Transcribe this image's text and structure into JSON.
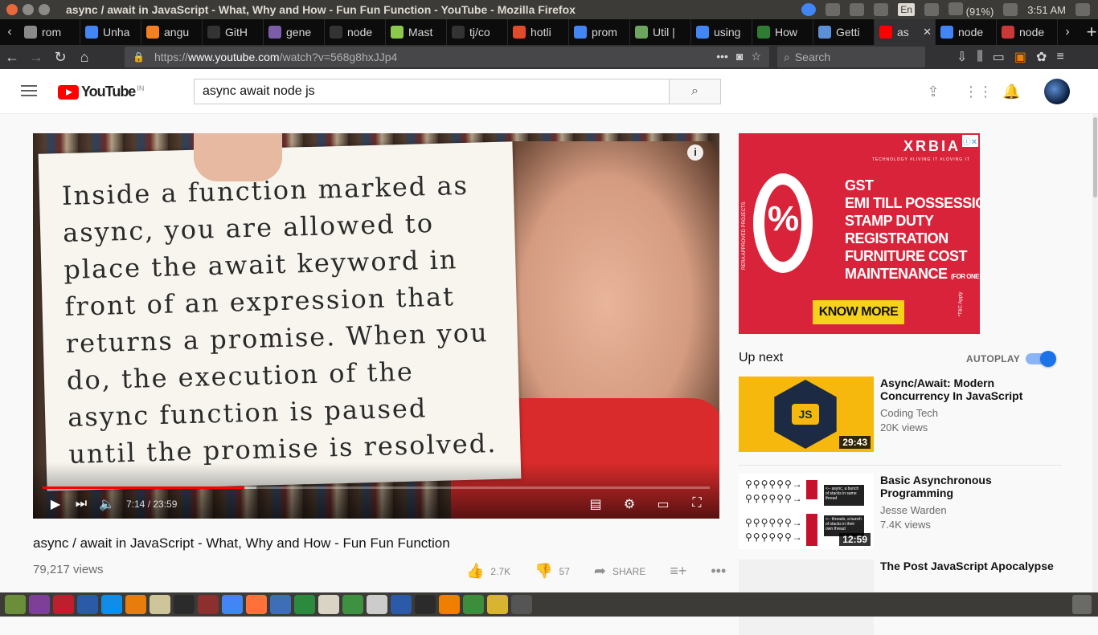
{
  "os": {
    "window_title": "async / await in JavaScript - What, Why and How - Fun Fun Function - YouTube - Mozilla Firefox",
    "lang": "En",
    "battery": "(91%)",
    "clock": "3:51 AM"
  },
  "tabs": [
    {
      "label": "rom",
      "color": "#8a8a8a"
    },
    {
      "label": "Unha",
      "color": "#4285f4"
    },
    {
      "label": "angu",
      "color": "#f48024"
    },
    {
      "label": "GitH",
      "color": "#333333"
    },
    {
      "label": "gene",
      "color": "#7b5ea7"
    },
    {
      "label": "node",
      "color": "#333333"
    },
    {
      "label": "Mast",
      "color": "#8cc84b"
    },
    {
      "label": "tj/co",
      "color": "#333333"
    },
    {
      "label": "hotli",
      "color": "#e14a2b"
    },
    {
      "label": "prom",
      "color": "#4285f4"
    },
    {
      "label": "Util |",
      "color": "#6da55f"
    },
    {
      "label": "using",
      "color": "#4285f4"
    },
    {
      "label": "How",
      "color": "#2e7d32"
    },
    {
      "label": "Getti",
      "color": "#5c8fd6"
    },
    {
      "label": "as",
      "color": "#ff0000",
      "active": true
    },
    {
      "label": "node",
      "color": "#4285f4"
    },
    {
      "label": "node",
      "color": "#cb3837"
    }
  ],
  "nav": {
    "url_prefix": "https://",
    "url_host": "www.youtube.com",
    "url_path": "/watch?v=568g8hxJJp4",
    "search_placeholder": "Search"
  },
  "youtube": {
    "logo": "YouTube",
    "country": "IN",
    "search_value": "async await node js"
  },
  "video": {
    "sign_text": "Inside a function marked as async, you are allowed to place the await keyword in front of an expression that returns a promise. When you do, the execution of the async function is paused until the promise is resolved.",
    "time": "7:14 / 23:59",
    "progress_played": 0.303,
    "progress_buffered": 0.32,
    "title": "async / await in JavaScript - What, Why and How - Fun Fun Function",
    "views": "79,217 views",
    "likes": "2.7K",
    "dislikes": "57",
    "share": "SHARE"
  },
  "ad": {
    "brand": "XRBIA",
    "tagline": "TECHNOLOGY #LIVING IT #LOVING IT",
    "lines": [
      "GST",
      "EMI TILL POSSESSION",
      "STAMP DUTY",
      "REGISTRATION",
      "FURNITURE COST",
      "MAINTENANCE"
    ],
    "for_one_year": "(FOR ONE YEAR)",
    "cta": "KNOW MORE",
    "side_text": "RERA APPROVED PROJECTS",
    "tc": "*T&C Apply"
  },
  "sidebar": {
    "up_next": "Up next",
    "autoplay": "AUTOPLAY",
    "recommendations": [
      {
        "title": "Async/Await: Modern Concurrency In JavaScript",
        "channel": "Coding Tech",
        "views": "20K views",
        "duration": "29:43",
        "badge": "JS"
      },
      {
        "title": "Basic Asynchronous Programming",
        "channel": "Jesse Warden",
        "views": "7.4K views",
        "duration": "12:59",
        "note1": "<-- async, a bunch of stacks in same thread",
        "note2": "<-- threads, a bunch of stacks in their own thread"
      },
      {
        "title": "The Post JavaScript Apocalypse",
        "channel": "",
        "views": "",
        "duration": ""
      }
    ]
  },
  "taskbar": [
    {
      "name": "ubuntu-dash",
      "color": "#6b8e3a"
    },
    {
      "name": "purple-app",
      "color": "#7e3f98"
    },
    {
      "name": "filezilla",
      "color": "#bf1e2d"
    },
    {
      "name": "visual-studio",
      "color": "#2a5aa8"
    },
    {
      "name": "teamviewer",
      "color": "#0e8ee9"
    },
    {
      "name": "blender",
      "color": "#e87d0d"
    },
    {
      "name": "disk-utility",
      "color": "#cfc59a"
    },
    {
      "name": "terminal",
      "color": "#2b2b2b"
    },
    {
      "name": "calendar",
      "color": "#8b2f2f"
    },
    {
      "name": "chrome",
      "color": "#4285f4"
    },
    {
      "name": "firefox",
      "color": "#ff7139"
    },
    {
      "name": "document-viewer",
      "color": "#3f6eb8"
    },
    {
      "name": "spreadsheet",
      "color": "#2b8a3e"
    },
    {
      "name": "text-editor",
      "color": "#d9d4c4"
    },
    {
      "name": "mongodb",
      "color": "#3f9142"
    },
    {
      "name": "vim",
      "color": "#cccccc"
    },
    {
      "name": "mysql-workbench",
      "color": "#2a5aa8"
    },
    {
      "name": "terminal-2",
      "color": "#2b2b2b"
    },
    {
      "name": "sublime",
      "color": "#f07e00"
    },
    {
      "name": "calculator",
      "color": "#3c8d3c"
    },
    {
      "name": "goat-app",
      "color": "#d7b531"
    },
    {
      "name": "ubuntu-settings",
      "color": "#555555"
    }
  ]
}
